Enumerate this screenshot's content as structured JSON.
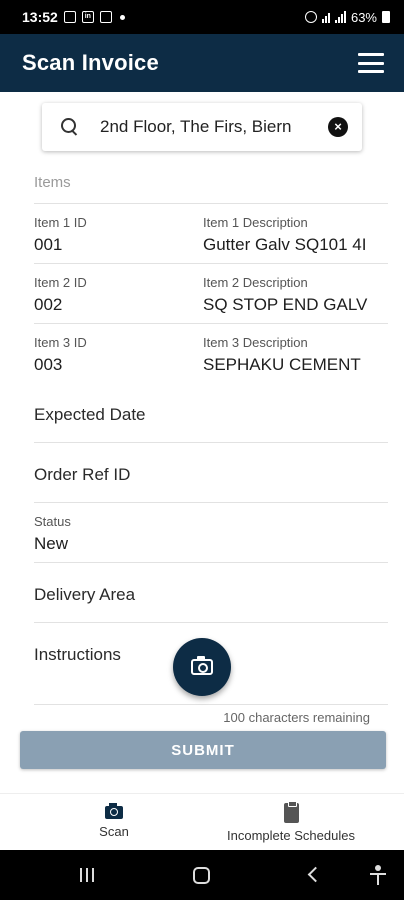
{
  "status_bar": {
    "time": "13:52",
    "battery": "63%",
    "notification_icons": [
      "gallery-icon",
      "linkedin-icon",
      "mail-icon"
    ],
    "indicator_icons": [
      "alarm-icon",
      "wifi-icon",
      "signal-icon",
      "battery-icon"
    ]
  },
  "app_bar": {
    "title": "Scan Invoice",
    "menu_icon": "hamburger-menu-icon"
  },
  "search": {
    "value": "2nd Floor, The Firs, Biern",
    "search_icon": "search-icon",
    "clear_icon": "clear-icon"
  },
  "items_section": {
    "label": "Items",
    "items": [
      {
        "id_label": "Item 1 ID",
        "id_value": "001",
        "desc_label": "Item 1 Description",
        "desc_value": "Gutter Galv SQ101 4I"
      },
      {
        "id_label": "Item 2 ID",
        "id_value": "002",
        "desc_label": "Item 2 Description",
        "desc_value": "SQ STOP END GALV"
      },
      {
        "id_label": "Item 3 ID",
        "id_value": "003",
        "desc_label": "Item 3 Description",
        "desc_value": "SEPHAKU CEMENT"
      }
    ]
  },
  "form": {
    "expected_date_label": "Expected Date",
    "order_ref_label": "Order Ref ID",
    "status_label": "Status",
    "status_value": "New",
    "delivery_area_label": "Delivery Area",
    "instructions_label": "Instructions",
    "chars_remaining": "100 characters remaining"
  },
  "submit_label": "SUBMIT",
  "bottom_nav": {
    "scan_label": "Scan",
    "incomplete_label": "Incomplete Schedules"
  },
  "colors": {
    "primary": "#0d2c45",
    "submit_disabled": "#8aa0b3"
  }
}
